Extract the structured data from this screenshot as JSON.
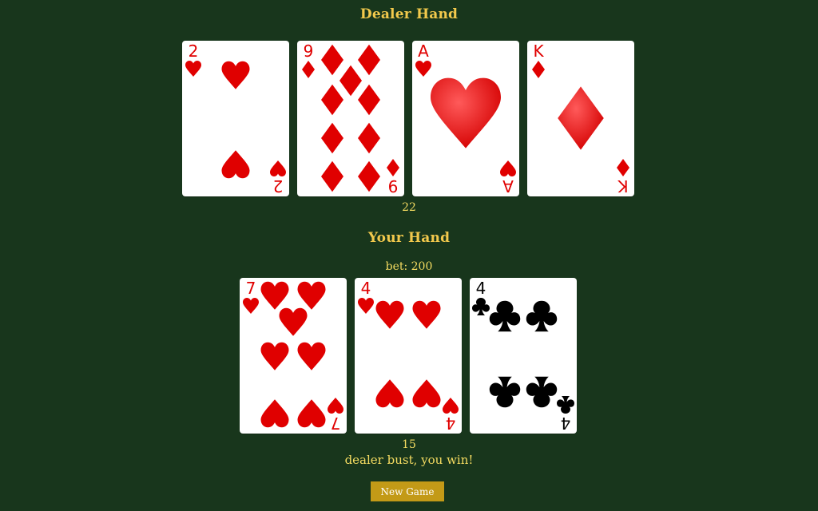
{
  "dealer": {
    "title": "Dealer Hand",
    "total": "22",
    "cards": [
      {
        "rank": "2",
        "suit": "hearts"
      },
      {
        "rank": "9",
        "suit": "diamonds"
      },
      {
        "rank": "A",
        "suit": "hearts"
      },
      {
        "rank": "K",
        "suit": "diamonds"
      }
    ]
  },
  "player": {
    "title": "Your Hand",
    "bet": "bet: 200",
    "total": "15",
    "cards": [
      {
        "rank": "7",
        "suit": "hearts"
      },
      {
        "rank": "4",
        "suit": "hearts"
      },
      {
        "rank": "4",
        "suit": "clubs"
      }
    ]
  },
  "result": "dealer bust, you win!",
  "new_game_label": "New Game",
  "colors": {
    "table": "#18361c",
    "title": "#f2c94c",
    "text": "#f5dc61",
    "red_suit": "#e00000",
    "black_suit": "#000000",
    "button": "#c39a17"
  }
}
